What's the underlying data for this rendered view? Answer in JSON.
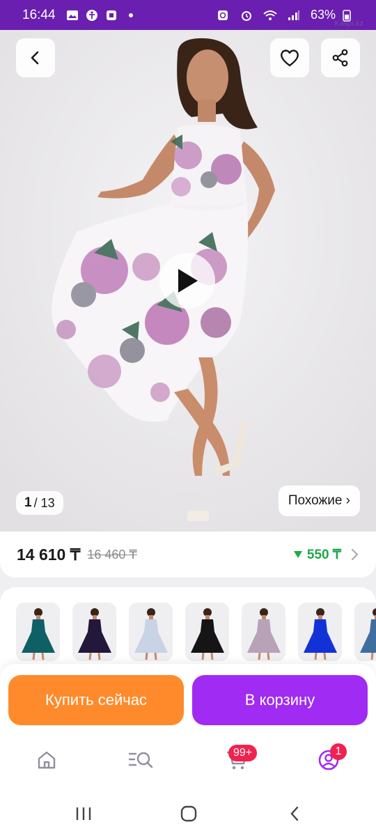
{
  "status_bar": {
    "time": "16:44",
    "battery": "63%",
    "icons": [
      "gallery-icon",
      "accessibility-icon",
      "app-icon",
      "dot-icon",
      "alarm-icon",
      "wifi-icon",
      "signal-icon",
      "battery-icon"
    ],
    "watermark": "Kaspi.kz"
  },
  "hero": {
    "counter_current": "1",
    "counter_total": "/ 13",
    "similar_label": "Похожие ›"
  },
  "price": {
    "current": "14 610 ₸",
    "old": "16 460 ₸",
    "discount": "550 ₸"
  },
  "thumbnails": [
    {
      "name": "teal dress",
      "color": "#0f5f67"
    },
    {
      "name": "dark floral dress",
      "color": "#23173c"
    },
    {
      "name": "light floral dress",
      "color": "#c8d3e6"
    },
    {
      "name": "black dress",
      "color": "#151515"
    },
    {
      "name": "lilac floral dress",
      "color": "#b7a2b8"
    },
    {
      "name": "blue dress",
      "color": "#1232d8"
    },
    {
      "name": "blue floral dress",
      "color": "#3f6e9e"
    }
  ],
  "actions": {
    "buy_now": "Купить сейчас",
    "add_to_cart": "В корзину"
  },
  "tabbar": {
    "cart_badge": "99+",
    "profile_badge": "1"
  },
  "colors": {
    "accent_purple": "#a02bf2",
    "accent_orange": "#ff8a2b",
    "discount_green": "#1fa84a",
    "badge_red": "#f0224f"
  }
}
